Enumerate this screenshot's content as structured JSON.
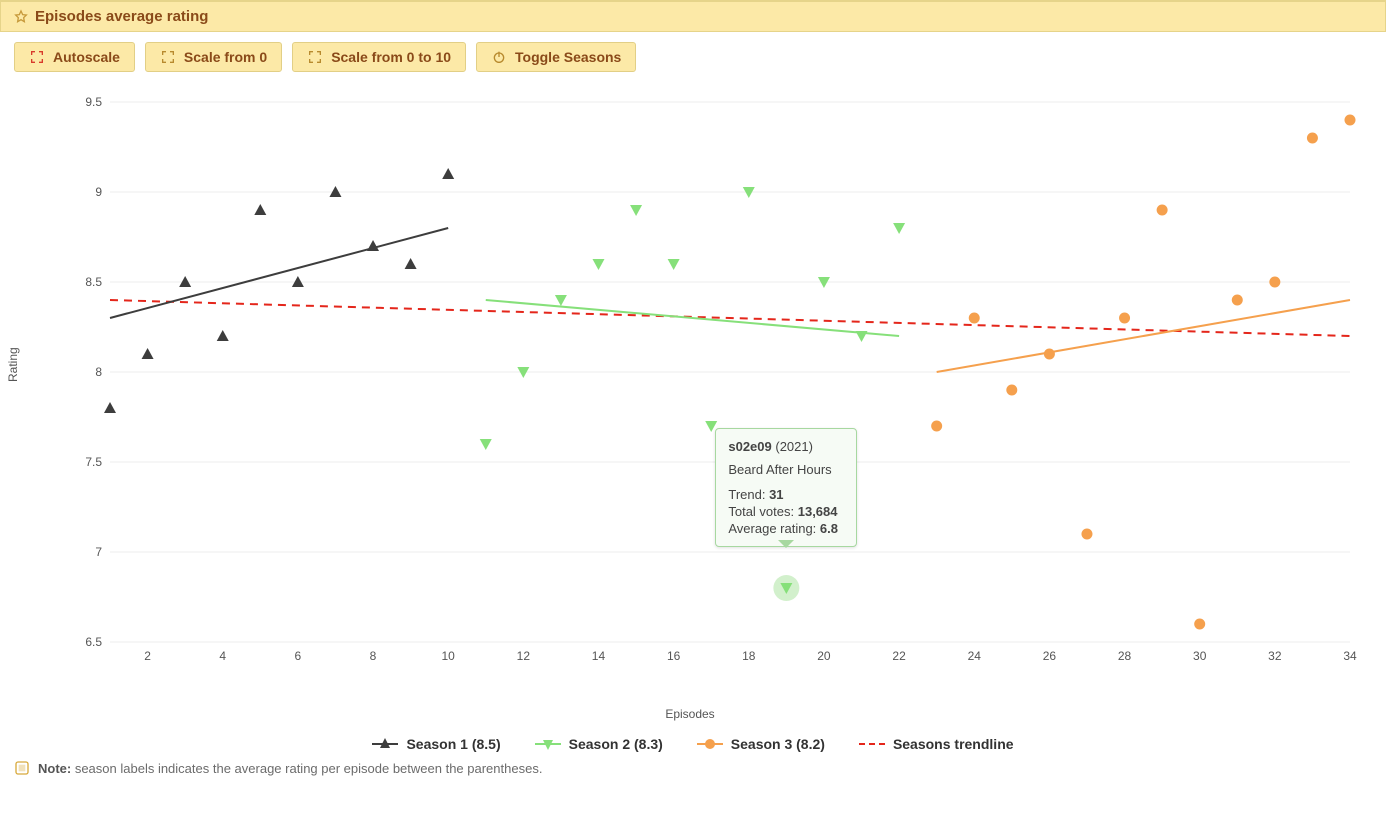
{
  "header": {
    "title": "Episodes average rating"
  },
  "toolbar": {
    "autoscale": "Autoscale",
    "scale0": "Scale from 0",
    "scale010": "Scale from 0 to 10",
    "toggle": "Toggle Seasons"
  },
  "axes": {
    "x": "Episodes",
    "y": "Rating"
  },
  "legend": {
    "s1": "Season 1 (8.5)",
    "s2": "Season 2 (8.3)",
    "s3": "Season 3 (8.2)",
    "trend": "Seasons trendline"
  },
  "note": {
    "label": "Note:",
    "text": " season labels indicates the average rating per episode between the parentheses."
  },
  "tooltip": {
    "code": "s02e09",
    "year": "(2021)",
    "title": "Beard After Hours",
    "trend_l": "Trend: ",
    "trend": "31",
    "votes_l": "Total votes: ",
    "votes": "13,684",
    "avg_l": "Average rating: ",
    "avg": "6.8"
  },
  "chart_data": {
    "type": "scatter",
    "xlabel": "Episodes",
    "ylabel": "Rating",
    "xlim": [
      1,
      34
    ],
    "ylim": [
      6.5,
      9.5
    ],
    "xticks": [
      2,
      4,
      6,
      8,
      10,
      12,
      14,
      16,
      18,
      20,
      22,
      24,
      26,
      28,
      30,
      32,
      34
    ],
    "yticks": [
      6.5,
      7,
      7.5,
      8,
      8.5,
      9,
      9.5
    ],
    "series": [
      {
        "name": "Season 1 (8.5)",
        "marker": "triangle-up",
        "color": "#3d3d3d",
        "x": [
          1,
          2,
          3,
          4,
          5,
          6,
          7,
          8,
          9,
          10
        ],
        "y": [
          7.8,
          8.1,
          8.5,
          8.2,
          8.9,
          8.5,
          9.0,
          8.7,
          8.6,
          9.1
        ],
        "trend": {
          "x": [
            1,
            10
          ],
          "y": [
            8.3,
            8.8
          ]
        }
      },
      {
        "name": "Season 2 (8.3)",
        "marker": "triangle-down",
        "color": "#86e07a",
        "x": [
          11,
          12,
          13,
          14,
          15,
          16,
          17,
          18,
          19,
          20,
          21,
          22
        ],
        "y": [
          7.6,
          8.0,
          8.4,
          8.6,
          8.9,
          8.6,
          7.7,
          9.0,
          6.8,
          8.5,
          8.2,
          8.8
        ],
        "trend": {
          "x": [
            11,
            22
          ],
          "y": [
            8.4,
            8.2
          ]
        }
      },
      {
        "name": "Season 3 (8.2)",
        "marker": "circle",
        "color": "#f5a04d",
        "x": [
          23,
          24,
          25,
          26,
          27,
          28,
          29,
          30,
          31,
          32,
          33,
          34
        ],
        "y": [
          7.7,
          8.3,
          7.9,
          8.1,
          7.1,
          8.3,
          8.9,
          6.6,
          8.4,
          8.5,
          9.3,
          9.4
        ],
        "trend": {
          "x": [
            23,
            34
          ],
          "y": [
            8.0,
            8.4
          ]
        }
      }
    ],
    "overall_trend": {
      "x": [
        1,
        34
      ],
      "y": [
        8.4,
        8.2
      ]
    },
    "highlight": {
      "series": 1,
      "index": 8,
      "x": 19,
      "y": 6.8
    }
  }
}
